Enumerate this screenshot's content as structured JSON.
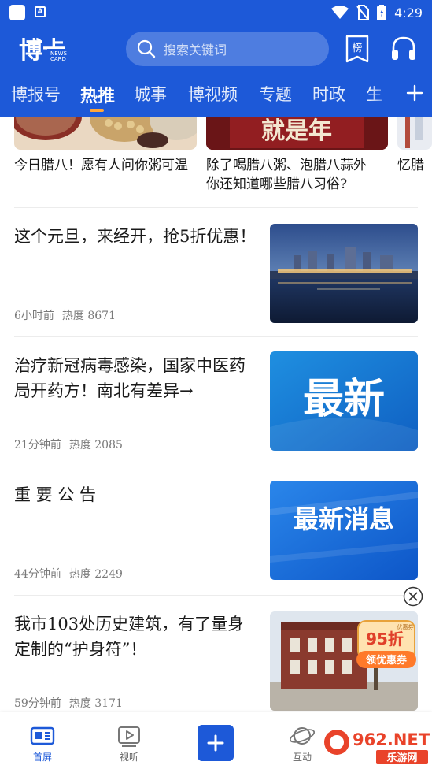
{
  "status_bar": {
    "time": "4:29"
  },
  "header": {
    "logo_text": "博卡",
    "logo_subtext": "NEWS CARD",
    "search_placeholder": "搜索关键词",
    "rank_label": "榜"
  },
  "tabs": [
    {
      "label": "博报号",
      "active": false
    },
    {
      "label": "热推",
      "active": true
    },
    {
      "label": "城事",
      "active": false
    },
    {
      "label": "博视频",
      "active": false
    },
    {
      "label": "专题",
      "active": false
    },
    {
      "label": "时政",
      "active": false
    },
    {
      "label": "生",
      "active": false
    }
  ],
  "top_strip": [
    {
      "caption": "今日腊八！愿有人问你粥可温"
    },
    {
      "caption_line1": "除了喝腊八粥、泡腊八蒜外",
      "caption_line2": "你还知道哪些腊八习俗?",
      "image_text": "就是年"
    },
    {
      "caption": "忆腊"
    }
  ],
  "articles": [
    {
      "title": "这个元旦，来经开，抢5折优惠！",
      "time": "6小时前",
      "heat": "热度 8671",
      "thumb": "city-night"
    },
    {
      "title": "治疗新冠病毒感染，国家中医药局开药方！南北有差异→",
      "time": "21分钟前",
      "heat": "热度 2085",
      "thumb": "text",
      "thumb_text": "最新"
    },
    {
      "title": "重 要 公 告",
      "time": "44分钟前",
      "heat": "热度 2249",
      "thumb": "text",
      "thumb_text": "最新消息"
    },
    {
      "title": "我市103处历史建筑，有了量身定制的“护身符”！",
      "time": "59分钟前",
      "heat": "热度 3171",
      "thumb": "building",
      "ad_discount": "95折",
      "ad_button": "领优惠券",
      "ad_corner": "优惠券"
    }
  ],
  "bottom_nav": [
    {
      "label": "首屏",
      "active": true
    },
    {
      "label": "视听",
      "active": false
    },
    {
      "label": "",
      "active": false
    },
    {
      "label": "互动",
      "active": false
    }
  ],
  "watermark": {
    "line1": "962.NET",
    "line2": "乐游网"
  },
  "colors": {
    "brand_blue": "#1d59d8",
    "accent_orange": "#ffa73a",
    "text": "#1a1a1a",
    "meta": "#7a7a7a"
  }
}
